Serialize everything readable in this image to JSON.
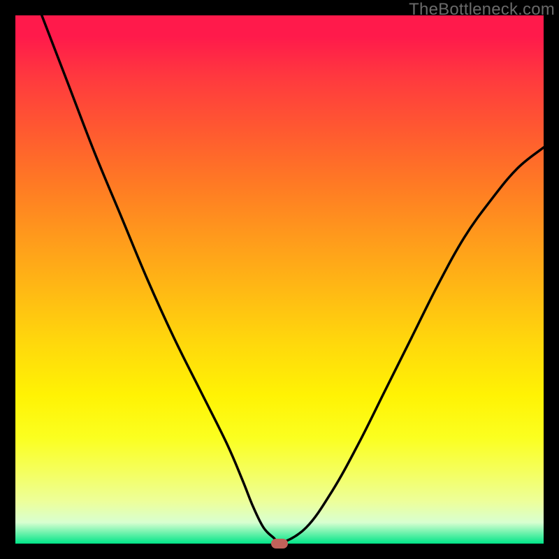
{
  "watermark": "TheBottleneck.com",
  "colors": {
    "frame": "#000000",
    "gradient_top": "#ff1a4b",
    "gradient_bottom": "#00e588",
    "curve": "#000000",
    "marker": "#c1625a"
  },
  "chart_data": {
    "type": "line",
    "title": "",
    "xlabel": "",
    "ylabel": "",
    "xlim": [
      0,
      100
    ],
    "ylim": [
      0,
      100
    ],
    "grid": false,
    "legend": false,
    "series": [
      {
        "name": "bottleneck-curve",
        "x": [
          5,
          10,
          15,
          20,
          25,
          30,
          35,
          40,
          43,
          45,
          47,
          49,
          50,
          55,
          60,
          65,
          70,
          75,
          80,
          85,
          90,
          95,
          100
        ],
        "values": [
          100,
          87,
          74,
          62,
          50,
          39,
          29,
          19,
          12,
          7,
          3,
          1,
          0,
          3,
          10,
          19,
          29,
          39,
          49,
          58,
          65,
          71,
          75
        ]
      }
    ],
    "marker": {
      "x": 50,
      "y": 0
    },
    "annotations": []
  }
}
